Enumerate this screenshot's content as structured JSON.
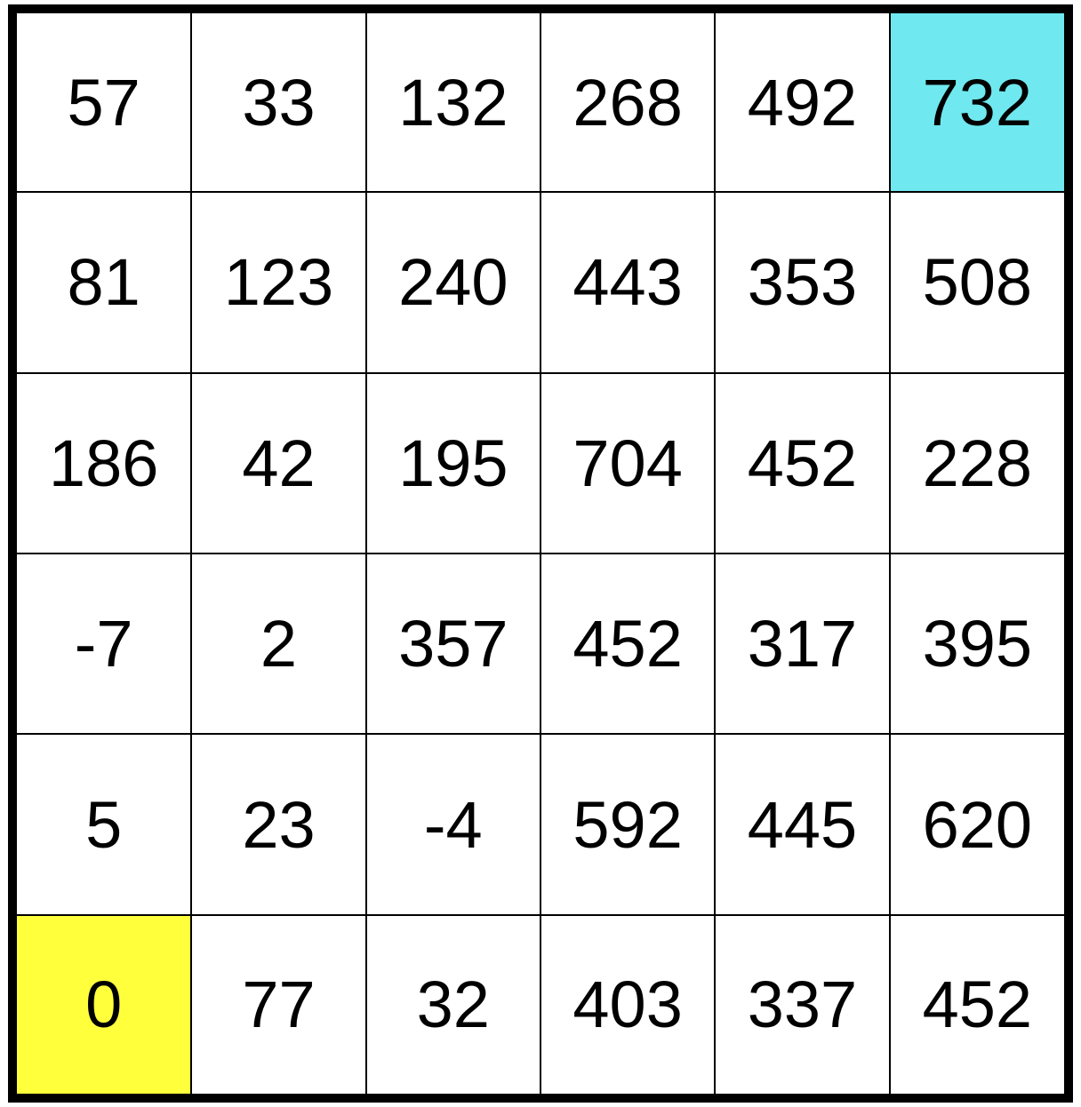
{
  "grid": {
    "rows": [
      [
        "57",
        "33",
        "132",
        "268",
        "492",
        "732"
      ],
      [
        "81",
        "123",
        "240",
        "443",
        "353",
        "508"
      ],
      [
        "186",
        "42",
        "195",
        "704",
        "452",
        "228"
      ],
      [
        "-7",
        "2",
        "357",
        "452",
        "317",
        "395"
      ],
      [
        "5",
        "23",
        "-4",
        "592",
        "445",
        "620"
      ],
      [
        "0",
        "77",
        "32",
        "403",
        "337",
        "452"
      ]
    ],
    "highlights": [
      {
        "row": 0,
        "col": 5,
        "color": "#6FE9EF",
        "name": "goal-cell"
      },
      {
        "row": 5,
        "col": 0,
        "color": "#FFFF3C",
        "name": "start-cell"
      }
    ]
  }
}
